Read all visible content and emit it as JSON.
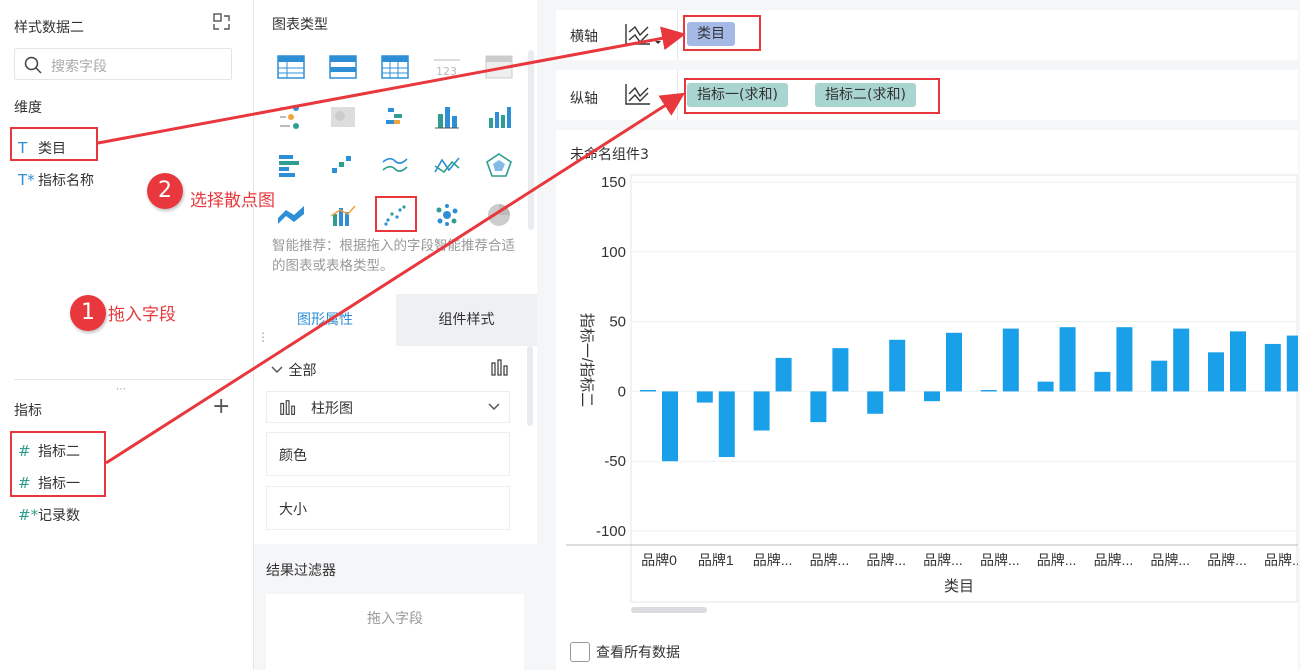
{
  "left": {
    "dataset_title": "样式数据二",
    "search_placeholder": "搜索字段",
    "dimension_header": "维度",
    "dimensions": [
      {
        "icon": "T",
        "label": "类目"
      },
      {
        "icon": "T*",
        "label": "指标名称"
      }
    ],
    "measure_header": "指标",
    "add_icon": "+",
    "measures": [
      {
        "icon": "#",
        "label": "指标二"
      },
      {
        "icon": "#",
        "label": "指标一"
      },
      {
        "icon": "#*",
        "label": "记录数"
      }
    ]
  },
  "middle": {
    "chart_type_header": "图表类型",
    "hint": "智能推荐：根据拖入的字段智能推荐合适的图表或表格类型。",
    "tabs": [
      "图形属性",
      "组件样式"
    ],
    "all_label": "全部",
    "chart_select": "柱形图",
    "color_label": "颜色",
    "size_label": "大小",
    "filter_header": "结果过滤器",
    "filter_drop": "拖入字段"
  },
  "right": {
    "x_axis_label": "横轴",
    "y_axis_label": "纵轴",
    "x_pills": [
      "类目"
    ],
    "y_pills": [
      "指标一(求和)",
      "指标二(求和)"
    ],
    "component_title": "未命名组件3",
    "view_all": "查看所有数据"
  },
  "annotations": {
    "step1_num": "1",
    "step1_text": "拖入字段",
    "step2_num": "2",
    "step2_text": "选择散点图"
  },
  "chart_data": {
    "type": "bar",
    "xlabel": "类目",
    "ylabel": "指标一/指标二",
    "ylim": [
      -110,
      155
    ],
    "yticks": [
      150,
      100,
      50,
      0,
      -50,
      -100
    ],
    "categories": [
      "品牌0",
      "品牌1",
      "品牌...",
      "品牌...",
      "品牌...",
      "品牌...",
      "品牌...",
      "品牌...",
      "品牌...",
      "品牌...",
      "品牌...",
      "品牌..."
    ],
    "series": [
      {
        "values": [
          1,
          -8,
          -28,
          -22,
          -16,
          -7,
          1,
          7,
          14,
          22,
          28,
          34
        ],
        "color": "#1aa0e8"
      },
      {
        "values": [
          -50,
          -47,
          24,
          31,
          37,
          42,
          45,
          46,
          46,
          45,
          43,
          40
        ],
        "color": "#1aa0e8"
      }
    ],
    "grid": true
  },
  "colors": {
    "accent": "#1aa0e8",
    "pill": "#a9d5d1",
    "annotation": "#e8383d",
    "tab_active": "#2f8fd6"
  }
}
